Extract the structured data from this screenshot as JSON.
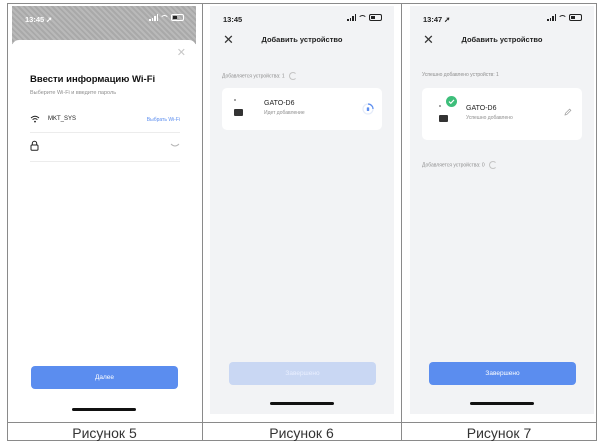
{
  "colors": {
    "accent": "#5B8DEF",
    "disabled": "#C9D7F3",
    "success": "#3DBE7A"
  },
  "captions": [
    "Рисунок 5",
    "Рисунок 6",
    "Рисунок 7"
  ],
  "screen5": {
    "time": "13:45",
    "title": "Ввести информацию Wi-Fi",
    "subtitle": "Выберите Wi-Fi и введите пароль",
    "ssid": "MKT_SYS",
    "choose_wifi": "Выбрать Wi-Fi",
    "password_value": "",
    "next_button": "Далее",
    "icons": {
      "close": "close-icon",
      "wifi": "wifi-icon",
      "lock": "lock-icon",
      "eye": "eye-closed-icon"
    }
  },
  "screen6": {
    "time": "13:45",
    "title": "Добавить устройство",
    "adding_label": "Добавляется устройства: 1",
    "device_name": "GATO-D6",
    "device_status": "Идет добавление",
    "done_button": "Завершено"
  },
  "screen7": {
    "time": "13:47",
    "title": "Добавить устройство",
    "success_label": "Успешно добавлено устройств: 1",
    "device_name": "GATO-D6",
    "device_status": "Успешно добавлено",
    "adding_label": "Добавляется устройства: 0",
    "done_button": "Завершено"
  }
}
